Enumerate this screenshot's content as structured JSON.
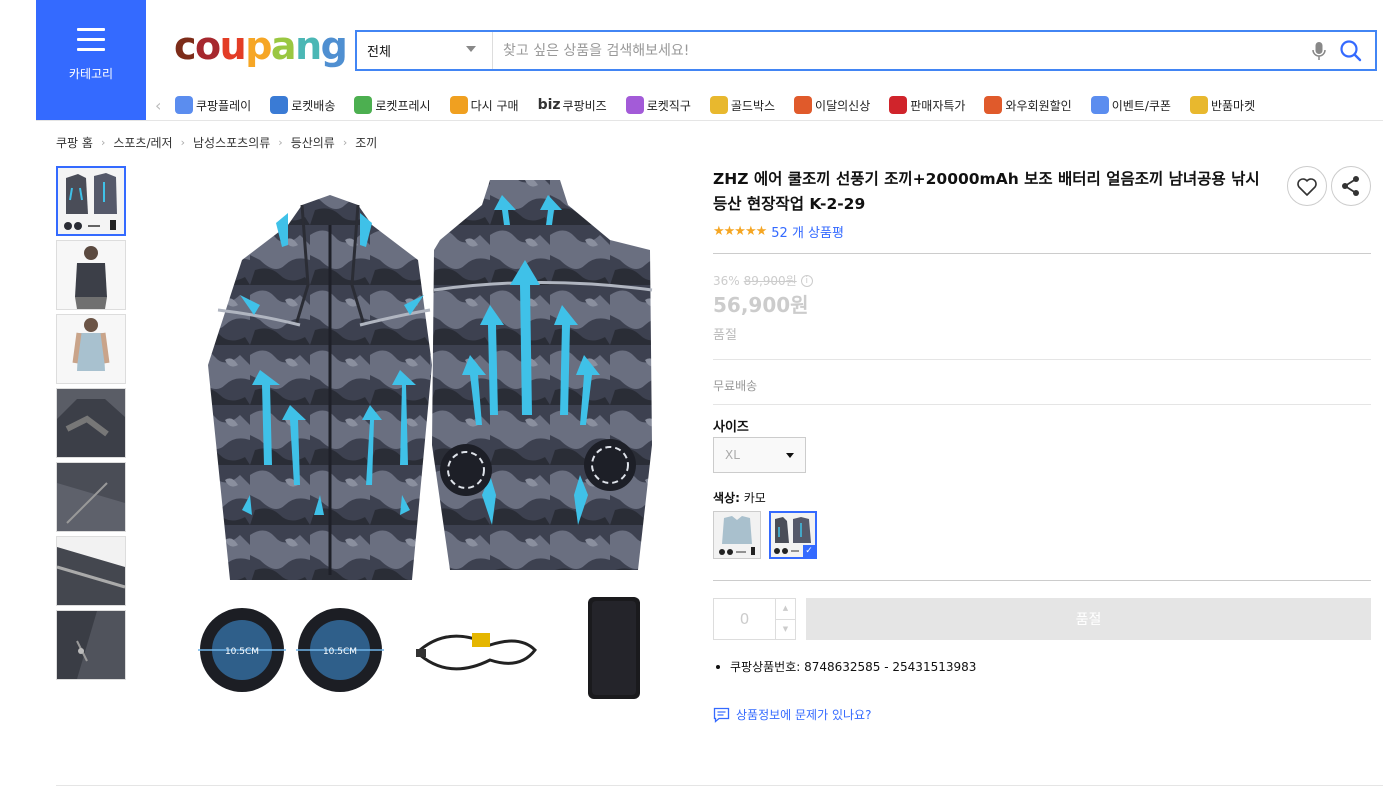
{
  "header": {
    "category_label": "카테고리",
    "logo": {
      "letters": [
        "c",
        "o",
        "u",
        "p",
        "a",
        "n",
        "g"
      ],
      "colors": [
        "#7d2c19",
        "#a6282e",
        "#e33d26",
        "#f6a625",
        "#9ac741",
        "#4bb7b5",
        "#4f8fd1"
      ]
    },
    "search": {
      "category": "전체",
      "placeholder": "찾고 싶은 상품을 검색해보세요!"
    },
    "accent_color": "#346aff"
  },
  "nav": {
    "items": [
      {
        "label": "쿠팡플레이",
        "icon": "play-icon",
        "color": "#5b8def"
      },
      {
        "label": "로켓배송",
        "icon": "rocket-icon",
        "color": "#3a7bd5"
      },
      {
        "label": "로켓프레시",
        "icon": "rocket-fresh-icon",
        "color": "#4caf50"
      },
      {
        "label": "다시 구매",
        "icon": "repurchase-icon",
        "color": "#f0a020"
      },
      {
        "label": "쿠팡비즈",
        "icon": "biz-icon",
        "prefix": "biz",
        "color": "#333333"
      },
      {
        "label": "로켓직구",
        "icon": "global-icon",
        "color": "#a35bd8"
      },
      {
        "label": "골드박스",
        "icon": "goldbox-icon",
        "color": "#e8b82e"
      },
      {
        "label": "이달의신상",
        "icon": "new-icon",
        "color": "#e05a2b"
      },
      {
        "label": "판매자특가",
        "icon": "percent-icon",
        "color": "#d0242b"
      },
      {
        "label": "와우회원할인",
        "icon": "wow-icon",
        "color": "#e05a2b"
      },
      {
        "label": "이벤트/쿠폰",
        "icon": "coupon-icon",
        "color": "#5b8def"
      },
      {
        "label": "반품마켓",
        "icon": "market-icon",
        "color": "#e8b82e"
      }
    ]
  },
  "breadcrumb": [
    "쿠팡 홈",
    "스포츠/레저",
    "남성스포츠의류",
    "등산의류",
    "조끼"
  ],
  "product": {
    "title": "ZHZ 에어 쿨조끼 선풍기 조끼+20000mAh 보조 배터리 얼음조끼 남녀공용 낚시 등산 현장작업 K-2-29",
    "rating_stars": "★★★★★",
    "rating": 4.5,
    "review_count": "52 개 상품평",
    "discount_rate": "36%",
    "original_price": "89,900원",
    "price": "56,900원",
    "status": "품절",
    "shipping": "무료배송",
    "size_label": "사이즈",
    "size_value": "XL",
    "color_label_key": "색상:",
    "color_value": "카모",
    "quantity": "0",
    "buy_button": "품절",
    "product_number": "쿠팡상품번호: 8748632585 - 25431513983",
    "report_link": "상품정보에 문제가 있나요?",
    "main_image_labels": {
      "fan": "10.5CM"
    }
  }
}
